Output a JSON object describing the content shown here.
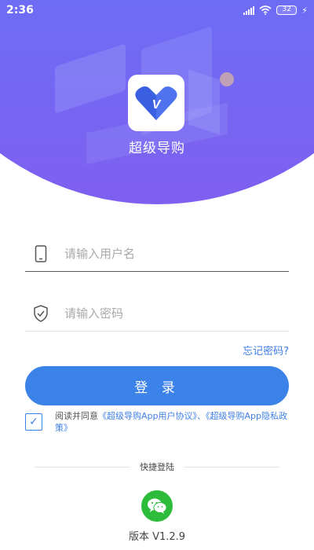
{
  "status_bar": {
    "time": "2:36",
    "battery": "32"
  },
  "app": {
    "name": "超级导购",
    "logo_letter": "V"
  },
  "login": {
    "username_placeholder": "请输入用户名",
    "password_placeholder": "请输入密码",
    "forgot_password": "忘记密码?",
    "submit_label": "登 录"
  },
  "agreement": {
    "checked": true,
    "prefix": "阅读并同意",
    "user_agreement": "《超级导购App用户协议》",
    "separator": "、",
    "privacy_policy": "《超级导购App隐私政策》"
  },
  "quick_login": {
    "label": "快捷登陆"
  },
  "version": "版本 V1.2.9",
  "colors": {
    "primary": "#3b82e9",
    "header_gradient_start": "#5b74f3",
    "header_gradient_end": "#7f5ff0",
    "wechat": "#2dbb3a"
  },
  "icons": {
    "username": "phone-icon",
    "password": "shield-check-icon",
    "quick_login": "wechat-icon"
  }
}
